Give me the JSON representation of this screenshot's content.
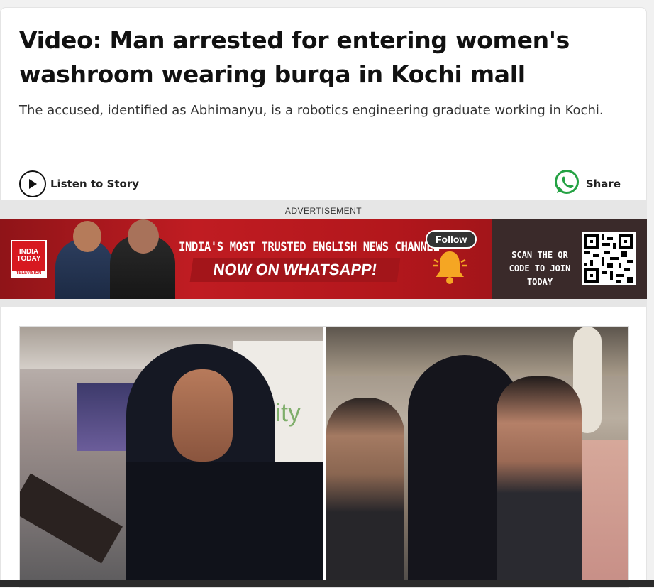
{
  "article": {
    "headline": "Video: Man arrested for entering women's washroom wearing burqa in Kochi mall",
    "summary": "The accused, identified as Abhimanyu, is a robotics engineering graduate working in Kochi."
  },
  "actions": {
    "listen_label": "Listen to Story",
    "share_label": "Share"
  },
  "advertisement": {
    "label": "ADVERTISEMENT",
    "brand_logo_text": "INDIA TODAY",
    "brand_logo_sub": "TELEVISION",
    "headline": "INDIA'S MOST TRUSTED ENGLISH NEWS CHANNEL",
    "cta": "NOW ON WHATSAPP!",
    "follow_label": "Follow",
    "scan_text": "SCAN THE QR CODE TO JOIN TODAY"
  },
  "photo": {
    "sign_text": "nity"
  },
  "colors": {
    "whatsapp_green": "#25a244",
    "ad_red": "#c01c22",
    "text_dark": "#111111"
  },
  "icons": {
    "listen": "play-icon",
    "share": "whatsapp-icon",
    "follow": "bell-icon"
  }
}
